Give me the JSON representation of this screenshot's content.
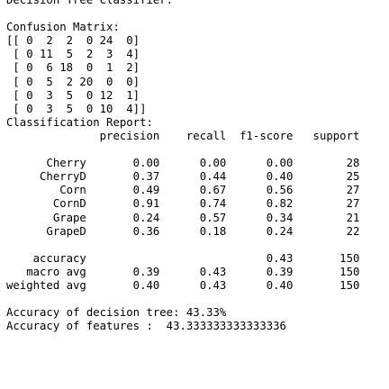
{
  "output": {
    "title": "Decision Tree Classifier:",
    "confusion_header": "Confusion Matrix:",
    "confusion_rows": [
      "[[ 0  2  2  0 24  0]",
      " [ 0 11  5  2  3  4]",
      " [ 0  6 18  0  1  2]",
      " [ 0  5  2 20  0  0]",
      " [ 0  3  5  0 12  1]",
      " [ 0  3  5  0 10  4]]"
    ],
    "report_header": "Classification Report:",
    "report_columns": "              precision    recall  f1-score   support",
    "report_rows": [
      "      Cherry       0.00      0.00      0.00        28",
      "     CherryD       0.37      0.44      0.40        25",
      "        Corn       0.49      0.67      0.56        27",
      "       CornD       0.91      0.74      0.82        27",
      "       Grape       0.24      0.57      0.34        21",
      "      GrapeD       0.36      0.18      0.24        22"
    ],
    "summary_rows": [
      "    accuracy                           0.43       150",
      "   macro avg       0.39      0.43      0.39       150",
      "weighted avg       0.40      0.43      0.40       150"
    ],
    "accuracy_tree": "Accuracy of decision tree: 43.33%",
    "accuracy_features": "Accuracy of features :  43.333333333333336"
  }
}
